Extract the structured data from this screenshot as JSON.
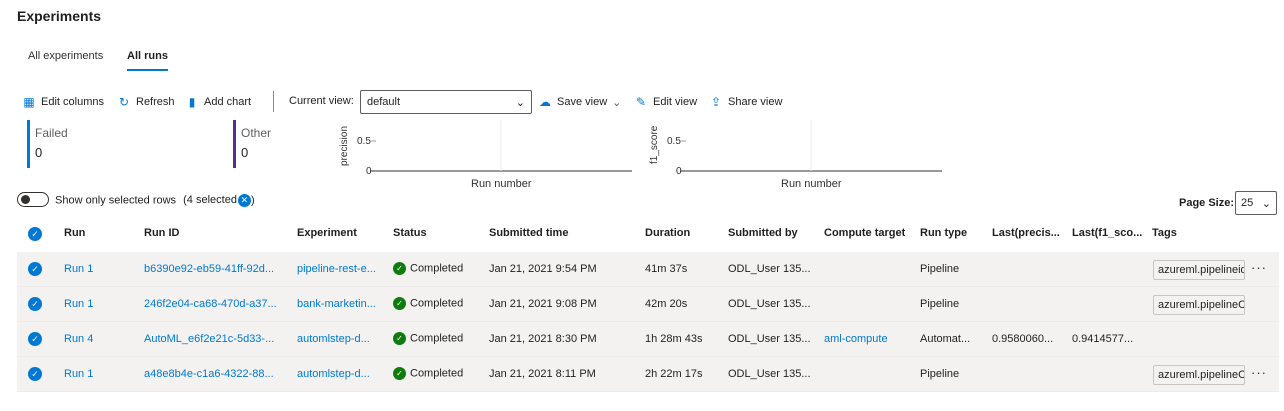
{
  "page": {
    "title": "Experiments"
  },
  "tabs": [
    {
      "label": "All experiments",
      "active": false
    },
    {
      "label": "All runs",
      "active": true
    }
  ],
  "toolbar": {
    "edit_columns": "Edit columns",
    "refresh": "Refresh",
    "add_chart": "Add chart",
    "current_view_label": "Current view:",
    "current_view_value": "default",
    "save_view": "Save view",
    "edit_view": "Edit view",
    "share_view": "Share view"
  },
  "tiles": [
    {
      "label": "Failed",
      "value": "0",
      "color": "#0078d4"
    },
    {
      "label": "Other",
      "value": "0",
      "color": "#5c2d91"
    }
  ],
  "charts": [
    {
      "ylabel": "precision",
      "tick_mid": "0.5",
      "tick_zero": "0",
      "xlabel": "Run number"
    },
    {
      "ylabel": "f1_score",
      "tick_mid": "0.5",
      "tick_zero": "0",
      "xlabel": "Run number"
    }
  ],
  "filter": {
    "toggle_label": "Show only selected rows",
    "selected_text": "(4 selected",
    "selected_suffix": ")"
  },
  "page_size": {
    "label": "Page Size:",
    "value": "25"
  },
  "table": {
    "headers": [
      "Run",
      "Run ID",
      "Experiment",
      "Status",
      "Submitted time",
      "Duration",
      "Submitted by",
      "Compute target",
      "Run type",
      "Last(precis...",
      "Last(f1_sco...",
      "Tags"
    ],
    "rows": [
      {
        "run": "Run 1",
        "run_id": "b6390e92-eb59-41ff-92d...",
        "experiment": "pipeline-rest-e...",
        "status": "Completed",
        "submitted": "Jan 21, 2021 9:54 PM",
        "duration": "41m 37s",
        "by": "ODL_User 135...",
        "compute": "",
        "type": "Pipeline",
        "precision": "",
        "f1": "",
        "tag": "azureml.pipelineid"
      },
      {
        "run": "Run 1",
        "run_id": "246f2e04-ca68-470d-a37...",
        "experiment": "bank-marketin...",
        "status": "Completed",
        "submitted": "Jan 21, 2021 9:08 PM",
        "duration": "42m 20s",
        "by": "ODL_User 135...",
        "compute": "",
        "type": "Pipeline",
        "precision": "",
        "f1": "",
        "tag": "azureml.pipelineC"
      },
      {
        "run": "Run 4",
        "run_id": "AutoML_e6f2e21c-5d33-...",
        "experiment": "automlstep-d...",
        "status": "Completed",
        "submitted": "Jan 21, 2021 8:30 PM",
        "duration": "1h 28m 43s",
        "by": "ODL_User 135...",
        "compute": "aml-compute",
        "type": "Automat...",
        "precision": "0.9580060...",
        "f1": "0.9414577...",
        "tag": ""
      },
      {
        "run": "Run 1",
        "run_id": "a48e8b4e-c1a6-4322-88...",
        "experiment": "automlstep-d...",
        "status": "Completed",
        "submitted": "Jan 21, 2021 8:11 PM",
        "duration": "2h 22m 17s",
        "by": "ODL_User 135...",
        "compute": "",
        "type": "Pipeline",
        "precision": "",
        "f1": "",
        "tag": "azureml.pipelineC"
      }
    ]
  },
  "colors": {
    "accent": "#0078d4",
    "success": "#107c10",
    "other": "#5c2d91"
  }
}
